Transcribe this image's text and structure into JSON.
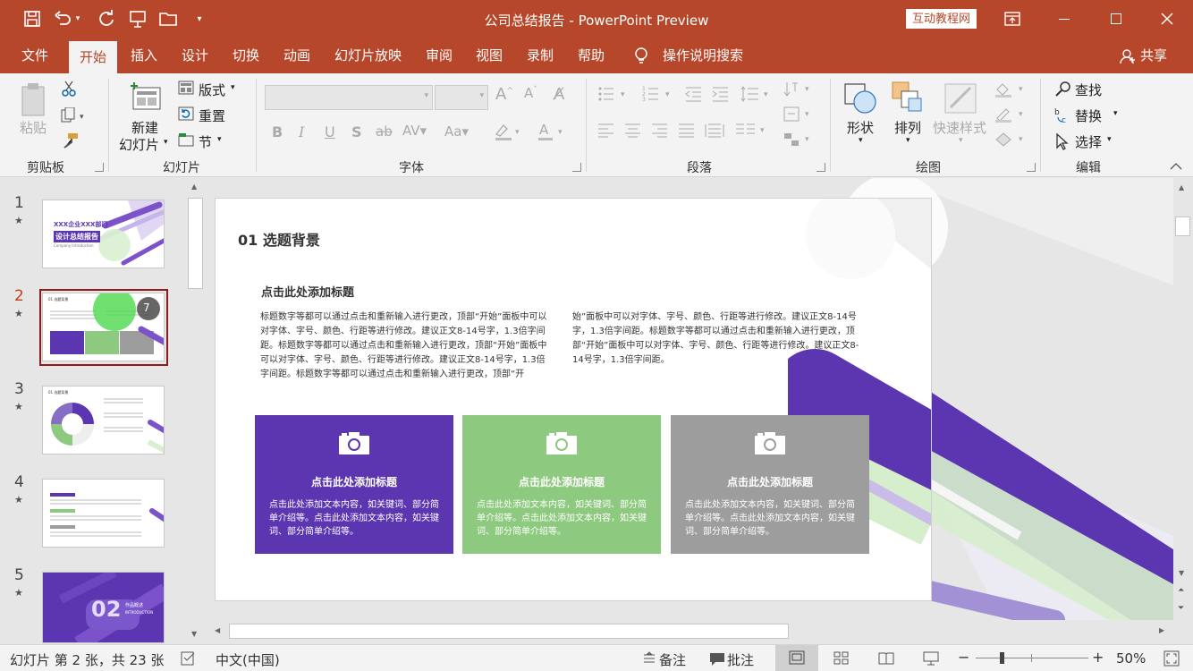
{
  "app": {
    "doc_title": "公司总结报告 - PowerPoint Preview",
    "badge": "互动教程网"
  },
  "tabs": [
    "文件",
    "开始",
    "插入",
    "设计",
    "切换",
    "动画",
    "幻灯片放映",
    "审阅",
    "视图",
    "录制",
    "帮助"
  ],
  "tell_me": "操作说明搜索",
  "share": "共享",
  "ribbon": {
    "clipboard": {
      "label": "剪贴板",
      "paste": "粘贴"
    },
    "slides": {
      "label": "幻灯片",
      "new_slide_1": "新建",
      "new_slide_2": "幻灯片",
      "layout": "版式",
      "reset": "重置",
      "section": "节"
    },
    "font": {
      "label": "字体",
      "font_name": "",
      "font_size": ""
    },
    "paragraph": {
      "label": "段落"
    },
    "drawing": {
      "label": "绘图",
      "shapes": "形状",
      "arrange": "排列",
      "quick_styles": "快速样式"
    },
    "editing": {
      "label": "编辑",
      "find": "查找",
      "replace": "替换",
      "select": "选择"
    }
  },
  "thumbnails": [
    {
      "num": "1",
      "title_a": "XXX企业XXX部门",
      "title_b": "设计总结报告",
      "sub": "Company Introduction"
    },
    {
      "num": "2",
      "badge": "7"
    },
    {
      "num": "3"
    },
    {
      "num": "4"
    },
    {
      "num": "5",
      "big": "02",
      "small_title": "作品概述",
      "small_sub": "INTRODUCTION"
    }
  ],
  "slide": {
    "heading": "01 选题背景",
    "subheading": "点击此处添加标题",
    "body_left": "标题数字等都可以通过点击和重新输入进行更改，顶部“开始”面板中可以对字体、字号、颜色、行距等进行修改。建议正文8-14号字，1.3倍字间距。标题数字等都可以通过点击和重新输入进行更改，顶部“开始”面板中可以对字体、字号、颜色、行距等进行修改。建议正文8-14号字，1.3倍字间距。标题数字等都可以通过点击和重新输入进行更改，顶部“开",
    "body_right": "始”面板中可以对字体、字号、颜色、行距等进行修改。建议正文8-14号字，1.3倍字间距。标题数字等都可以通过点击和重新输入进行更改，顶部“开始”面板中可以对字体、字号、颜色、行距等进行修改。建议正文8-14号字，1.3倍字间距。",
    "cards": [
      {
        "title": "点击此处添加标题",
        "body": "点击此处添加文本内容，如关键词、部分简单介绍等。点击此处添加文本内容，如关键词、部分简单介绍等。",
        "color": "#5b36b0"
      },
      {
        "title": "点击此处添加标题",
        "body": "点击此处添加文本内容，如关键词、部分简单介绍等。点击此处添加文本内容，如关键词、部分简单介绍等。",
        "color": "#8dc97e"
      },
      {
        "title": "点击此处添加标题",
        "body": "点击此处添加文本内容，如关键词、部分简单介绍等。点击此处添加文本内容，如关键词、部分简单介绍等。",
        "color": "#9d9d9d"
      }
    ]
  },
  "status": {
    "slide_info": "幻灯片 第 2 张，共 23 张",
    "language": "中文(中国)",
    "notes": "备注",
    "comments": "批注",
    "zoom": "50%"
  },
  "colors": {
    "accent": "#b7472a",
    "purple": "#5b36b0",
    "green": "#8dc97e"
  }
}
